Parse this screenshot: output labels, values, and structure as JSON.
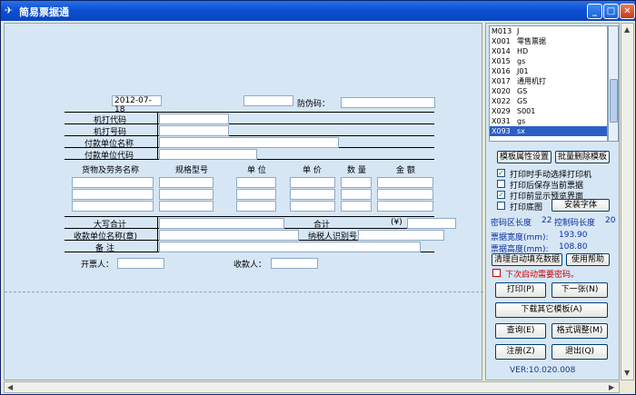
{
  "window": {
    "title": "简易票据通",
    "icon": "app-icon"
  },
  "form": {
    "date": "2012-07-18",
    "fangwei_label": "防伪码：",
    "jiqi_daima": "机打代码",
    "jiqi_haoma": "机打号码",
    "fukuan_mingcheng": "付款单位名称",
    "fukuan_daima": "付款单位代码",
    "col_goods": "货物及劳务名称",
    "col_spec": "规格型号",
    "col_unit": "单 位",
    "col_price": "单 价",
    "col_qty": "数 量",
    "col_amount": "金 额",
    "daxie": "大写合计",
    "heji": "合计",
    "yen": "(¥)",
    "shoukuan_mingcheng": "收款单位名称(章)",
    "nashui_hao": "纳税人识别号",
    "beizhu": "备 注",
    "kaipiaoren": "开票人：",
    "shoukuanren": "收款人："
  },
  "list": {
    "items": [
      {
        "code": "M013",
        "name": "J"
      },
      {
        "code": "X001",
        "name": "零售票据"
      },
      {
        "code": "X014",
        "name": "HD"
      },
      {
        "code": "X015",
        "name": "gs"
      },
      {
        "code": "X016",
        "name": "J01"
      },
      {
        "code": "X017",
        "name": "通用机打"
      },
      {
        "code": "X020",
        "name": "GS"
      },
      {
        "code": "X022",
        "name": "GS"
      },
      {
        "code": "X029",
        "name": "S001"
      },
      {
        "code": "X031",
        "name": "gs"
      },
      {
        "code": "X093",
        "name": "sx"
      }
    ],
    "selected": "X093"
  },
  "panel": {
    "btn_template_props": "模板属性设置",
    "btn_batch_delete": "批量删除模板",
    "chk_print_choose": "打印时手动选择打印机",
    "chk_print_save": "打印后保存当前票据",
    "chk_preview": "打印前显示预览界面",
    "chk_print_bg": "打印底图",
    "btn_install_font": "安装字体",
    "pw_len_label": "密码区长度",
    "pw_len_value": "22",
    "ctrl_len_label": "控制码长度",
    "ctrl_len_value": "20",
    "width_label": "票据宽度(mm):",
    "width_value": "193.90",
    "height_label": "票据高度(mm):",
    "height_value": "108.80",
    "btn_clear_autofill": "清理自动填充数据",
    "btn_help": "使用帮助",
    "chk_need_pw": "下次启动需要密码。",
    "btn_print": "打印(P)",
    "btn_next": "下一张(N)",
    "btn_download": "下载其它模板(A)",
    "btn_query": "查询(E)",
    "btn_format": "格式调整(M)",
    "btn_logout": "注册(Z)",
    "btn_exit": "退出(Q)",
    "version": "VER:10.020.008"
  },
  "checks": {
    "print_choose": true,
    "print_save": false,
    "preview": true,
    "print_bg": false,
    "need_pw": false
  }
}
